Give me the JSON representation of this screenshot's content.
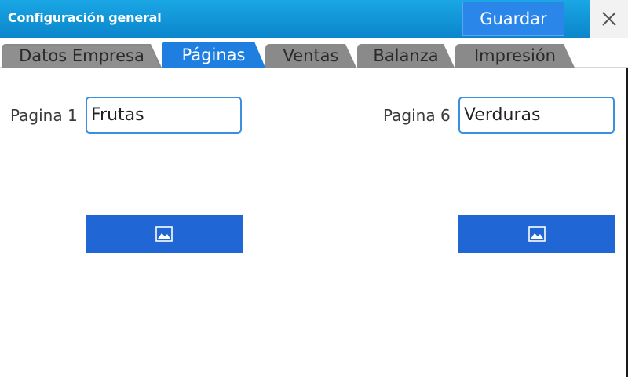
{
  "window": {
    "title": "Configuración general",
    "save_label": "Guardar",
    "close_icon": "close-icon"
  },
  "tabs": [
    {
      "label": "Datos Empresa",
      "active": false
    },
    {
      "label": "Páginas",
      "active": true
    },
    {
      "label": "Ventas",
      "active": false
    },
    {
      "label": "Balanza",
      "active": false
    },
    {
      "label": "Impresión",
      "active": false
    }
  ],
  "pages": [
    {
      "label": "Pagina 1",
      "value": "Frutas",
      "image_icon": "image-icon"
    },
    {
      "label": "Pagina 6",
      "value": "Verduras",
      "image_icon": "image-icon"
    }
  ],
  "colors": {
    "titlebar": "#0b86cc",
    "active_tab": "#1e7fe0",
    "inactive_tab": "#8a8a8a",
    "image_button": "#2066d4",
    "input_border": "#3a8fe0"
  }
}
